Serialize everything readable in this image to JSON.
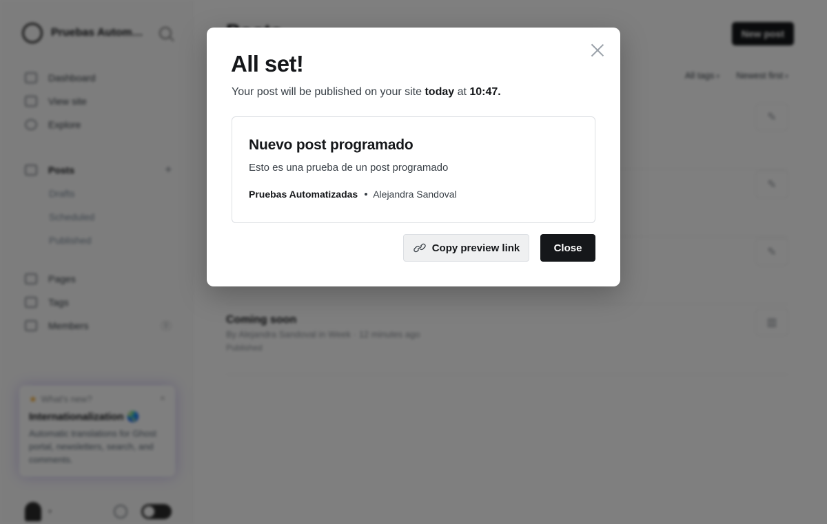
{
  "sidebar": {
    "site_name": "Pruebas Automatizadas",
    "nav": {
      "dashboard": "Dashboard",
      "view_site": "View site",
      "explore": "Explore",
      "posts": "Posts",
      "drafts": "Drafts",
      "scheduled": "Scheduled",
      "published": "Published",
      "pages": "Pages",
      "tags": "Tags",
      "members": "Members",
      "members_count": "0"
    },
    "promo": {
      "kicker": "What's new?",
      "title": "Internationalization 🌏",
      "body": "Automatic translations for Ghost portal, newsletters, search, and comments."
    }
  },
  "main": {
    "title": "Posts",
    "new_post_label": "New post",
    "filters": [
      "All tags",
      "Newest first"
    ],
    "posts": [
      {
        "title": "Coming soon",
        "meta": "By Alejandra Sandoval in Week · 12 minutes ago",
        "status": "Published"
      }
    ]
  },
  "modal": {
    "title": "All set!",
    "message_prefix": "Your post will be published on your site ",
    "message_when": "today",
    "message_at": " at ",
    "message_time": "10:47.",
    "post": {
      "title": "Nuevo post programado",
      "excerpt": "Esto es una prueba de un post programado",
      "site": "Pruebas Automatizadas",
      "author": "Alejandra Sandoval"
    },
    "copy_link_label": "Copy preview link",
    "close_label": "Close"
  },
  "colors": {
    "primary_button": "#15171a",
    "secondary_button": "#eff0f1",
    "overlay": "rgba(0,0,0,0.5)"
  }
}
